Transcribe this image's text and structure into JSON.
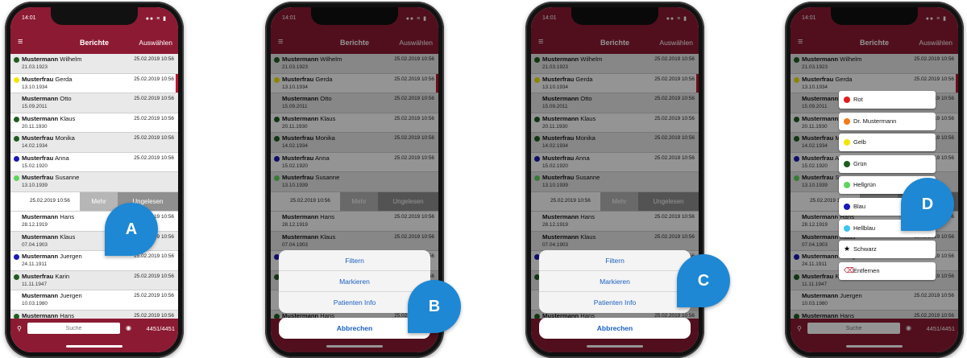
{
  "status": {
    "time": "14:01",
    "icons": "●● ≡ ▮"
  },
  "nav": {
    "menu": "≡",
    "title": "Berichte",
    "action": "Auswählen"
  },
  "rows": [
    {
      "surname": "Mustermann",
      "firstname": "Wilhelm",
      "dob": "21.03.1923",
      "date": "25.02.2019 10:56",
      "dot": "#1f5d1f"
    },
    {
      "surname": "Musterfrau",
      "firstname": "Gerda",
      "dob": "13.10.1934",
      "date": "25.02.2019 10:56",
      "dot": "#f2e600"
    },
    {
      "surname": "Mustermann",
      "firstname": "Otto",
      "dob": "15.09.2011",
      "date": "25.02.2019 10:56",
      "dot": ""
    },
    {
      "surname": "Mustermann",
      "firstname": "Klaus",
      "dob": "20.11.1930",
      "date": "25.02.2019 10:56",
      "dot": "#1f5d1f"
    },
    {
      "surname": "Musterfrau",
      "firstname": "Monika",
      "dob": "14.02.1934",
      "date": "25.02.2019 10:56",
      "dot": "#1f5d1f"
    },
    {
      "surname": "Musterfrau",
      "firstname": "Anna",
      "dob": "15.02.1920",
      "date": "25.02.2019 10:56",
      "dot": "#1a1ab4"
    },
    {
      "surname": "Musterfrau",
      "firstname": "Susanne",
      "dob": "13.10.1939",
      "date": "",
      "dot": "#5fd35f"
    },
    {
      "surname": "Mustermann",
      "firstname": "Hans",
      "dob": "28.12.1919",
      "date": "25.02.2019 10:56",
      "dot": ""
    },
    {
      "surname": "Mustermann",
      "firstname": "Klaus",
      "dob": "07.04.1903",
      "date": "25.02.2019 10:56",
      "dot": ""
    },
    {
      "surname": "Mustermann",
      "firstname": "Juergen",
      "dob": "24.11.1911",
      "date": "25.02.2019 10:56",
      "dot": "#1a1ab4"
    },
    {
      "surname": "Musterfrau",
      "firstname": "Karin",
      "dob": "11.11.1947",
      "date": "25.02.2019 10:56",
      "dot": "#1f5d1f"
    },
    {
      "surname": "Mustermann",
      "firstname": "Juergen",
      "dob": "10.03.1980",
      "date": "25.02.2019 10:56",
      "dot": ""
    },
    {
      "surname": "Mustermann",
      "firstname": "Hans",
      "dob": "",
      "date": "25.02.2019 10:56",
      "dot": "#1f5d1f"
    }
  ],
  "swipe": {
    "date": "25.02.2019 10:56",
    "more": "Mehr",
    "unread": "Ungelesen"
  },
  "search": {
    "placeholder": "Suche",
    "count": "4451/4451"
  },
  "sheet_b": {
    "items": [
      "Filtern",
      "Markieren",
      "Patienten Info"
    ],
    "cancel": "Abbrechen"
  },
  "sheet_c": {
    "items": [
      "Filtern",
      "Markieren",
      "Patienten Info"
    ],
    "cancel": "Abbrechen"
  },
  "marker_menu": [
    {
      "label": "Rot",
      "color": "#e01d1d",
      "icon": "dot"
    },
    {
      "label": "Dr. Mustermann",
      "color": "#f07a1a",
      "icon": "dot"
    },
    {
      "label": "Gelb",
      "color": "#f2e600",
      "icon": "dot"
    },
    {
      "label": "Grün",
      "color": "#1f5d1f",
      "icon": "dot"
    },
    {
      "label": "Hellgrün",
      "color": "#5fd35f",
      "icon": "dot"
    },
    {
      "label": "Blau",
      "color": "#1a1ab4",
      "icon": "dot"
    },
    {
      "label": "Hellblau",
      "color": "#3cc4f0",
      "icon": "dot"
    },
    {
      "label": "Schwarz",
      "color": "#000000",
      "icon": "star"
    },
    {
      "label": "Entfernen",
      "color": "#c0172e",
      "icon": "eraser"
    }
  ],
  "callouts": [
    "A",
    "B",
    "C",
    "D"
  ],
  "colors": {
    "brand": "#8c1a33",
    "callout": "#1e88d4",
    "action_blue": "#1b5fbf"
  }
}
